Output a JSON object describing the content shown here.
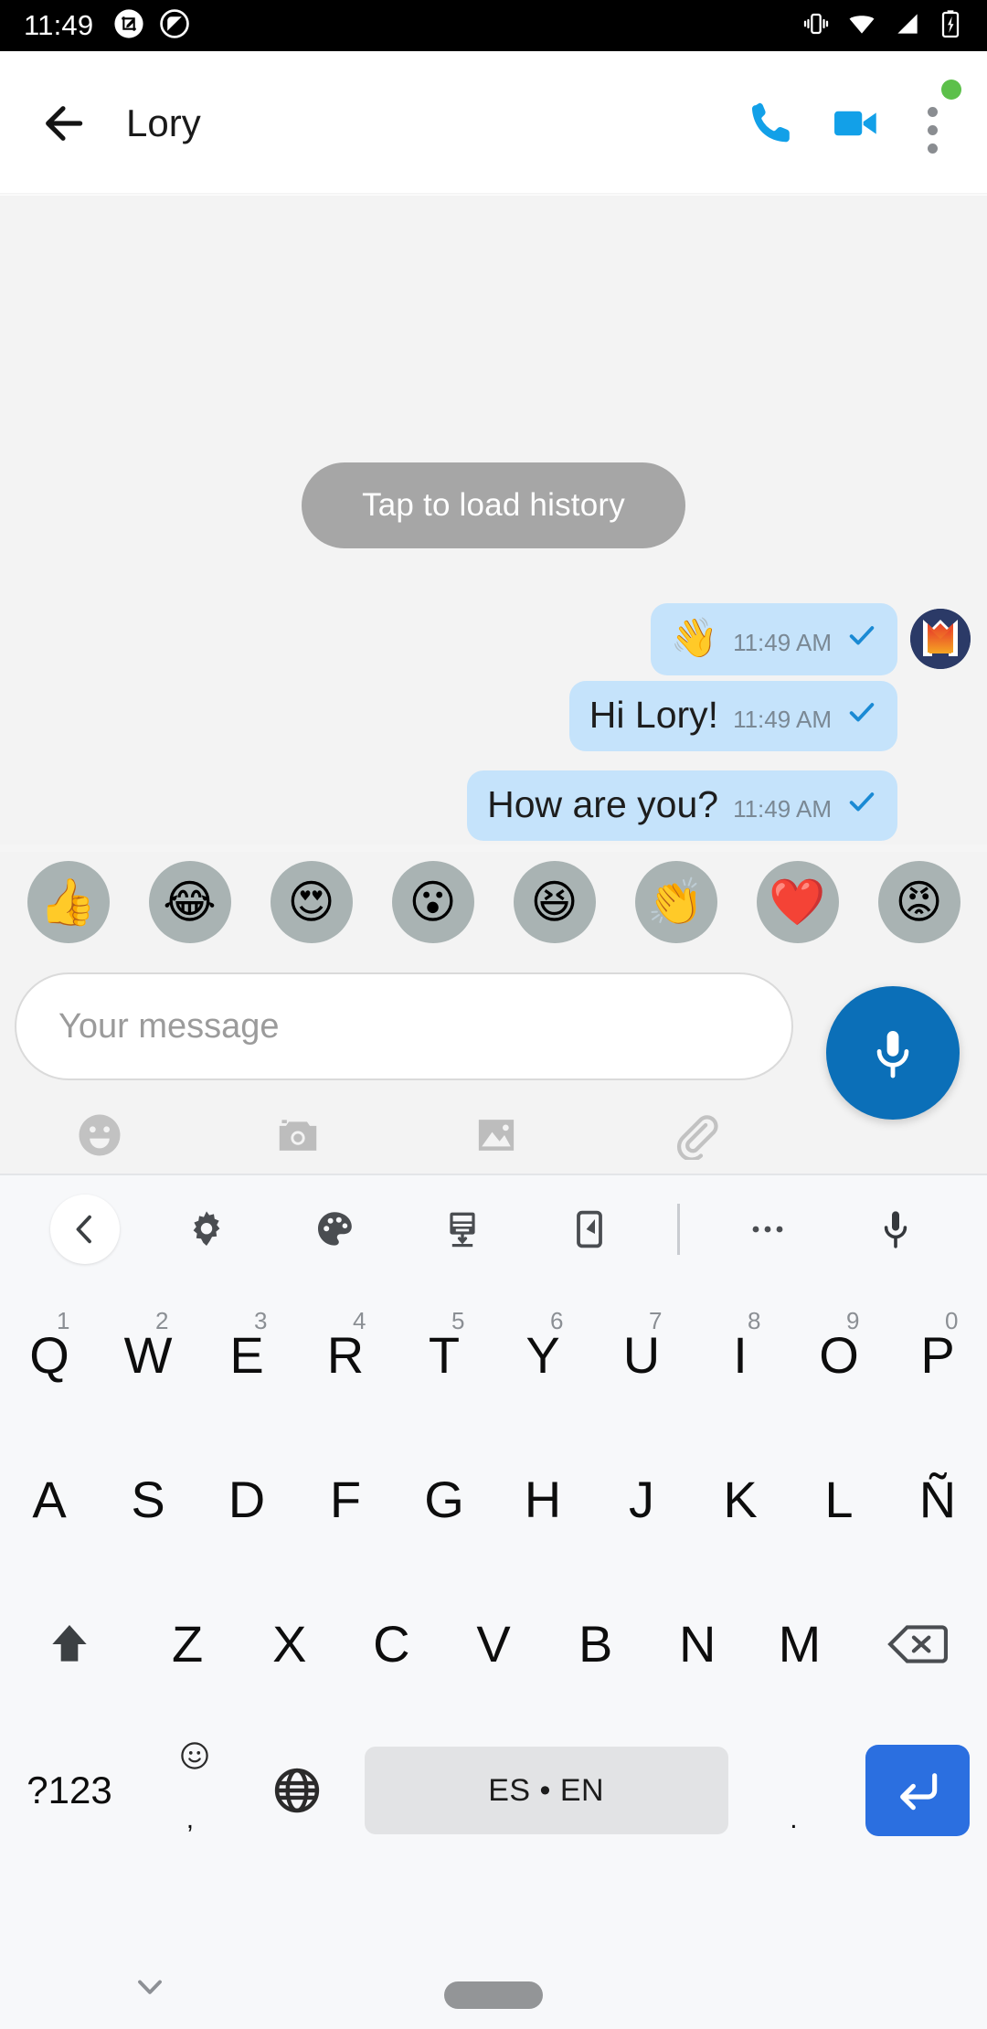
{
  "status_bar": {
    "time": "11:49",
    "left_icons": [
      "screenshot-crop-icon",
      "do-not-disturb-icon"
    ],
    "right_icons": [
      "vibrate-icon",
      "wifi-icon",
      "cellular-signal-icon",
      "battery-charging-icon"
    ]
  },
  "app_bar": {
    "back_icon": "back-arrow-icon",
    "contact_name": "Lory",
    "call_icon": "phone-call-icon",
    "video_icon": "video-camera-icon",
    "overflow_icon": "more-vertical-icon",
    "status_dot_color": "#5cc04a",
    "accent_color": "#12a0e8"
  },
  "conversation": {
    "load_history_label": "Tap to load history",
    "messages": [
      {
        "text": "👋",
        "emoji_only": true,
        "time": "11:49 AM",
        "status_icon": "check-sent-icon",
        "has_avatar": true
      },
      {
        "text": "Hi Lory!",
        "emoji_only": false,
        "time": "11:49 AM",
        "status_icon": "check-sent-icon",
        "has_avatar": false
      },
      {
        "text": "How are you?",
        "emoji_only": false,
        "time": "11:49 AM",
        "status_icon": "check-sent-icon",
        "has_avatar": false
      }
    ],
    "bubble_color": "#c5e3fb",
    "check_color": "#1a8ad4"
  },
  "reactions": [
    {
      "emoji": "👍",
      "name": "thumbs-up"
    },
    {
      "emoji": "😂",
      "name": "tears-of-joy"
    },
    {
      "emoji": "😍",
      "name": "heart-eyes"
    },
    {
      "emoji": "😮",
      "name": "open-mouth"
    },
    {
      "emoji": "😆",
      "name": "squinting-laugh"
    },
    {
      "emoji": "👏",
      "name": "clapping-hands"
    },
    {
      "emoji": "❤️",
      "name": "red-heart"
    },
    {
      "emoji": "😡",
      "name": "angry-face"
    }
  ],
  "composer": {
    "placeholder": "Your message",
    "value": "",
    "mic_icon": "microphone-icon",
    "mic_color": "#0b6fb8",
    "attachments": [
      {
        "name": "emoji-icon"
      },
      {
        "name": "camera-icon"
      },
      {
        "name": "gallery-image-icon"
      },
      {
        "name": "paperclip-attach-icon"
      }
    ]
  },
  "keyboard": {
    "toolbar": [
      {
        "name": "back-chevron-icon",
        "highlighted": true
      },
      {
        "name": "gear-settings-icon",
        "highlighted": false
      },
      {
        "name": "palette-theme-icon",
        "highlighted": false
      },
      {
        "name": "keyboard-resize-icon",
        "highlighted": false
      },
      {
        "name": "one-handed-mode-icon",
        "highlighted": false
      },
      {
        "name": "divider",
        "highlighted": false
      },
      {
        "name": "more-horizontal-icon",
        "highlighted": false
      },
      {
        "name": "voice-input-microphone-icon",
        "highlighted": false
      }
    ],
    "row1": [
      {
        "char": "Q",
        "hint": "1"
      },
      {
        "char": "W",
        "hint": "2"
      },
      {
        "char": "E",
        "hint": "3"
      },
      {
        "char": "R",
        "hint": "4"
      },
      {
        "char": "T",
        "hint": "5"
      },
      {
        "char": "Y",
        "hint": "6"
      },
      {
        "char": "U",
        "hint": "7"
      },
      {
        "char": "I",
        "hint": "8"
      },
      {
        "char": "O",
        "hint": "9"
      },
      {
        "char": "P",
        "hint": "0"
      }
    ],
    "row2": [
      {
        "char": "A"
      },
      {
        "char": "S"
      },
      {
        "char": "D"
      },
      {
        "char": "F"
      },
      {
        "char": "G"
      },
      {
        "char": "H"
      },
      {
        "char": "J"
      },
      {
        "char": "K"
      },
      {
        "char": "L"
      },
      {
        "char": "Ñ"
      }
    ],
    "row3": [
      {
        "char": "Z"
      },
      {
        "char": "X"
      },
      {
        "char": "C"
      },
      {
        "char": "V"
      },
      {
        "char": "B"
      },
      {
        "char": "N"
      },
      {
        "char": "M"
      }
    ],
    "shift_icon": "shift-arrow-icon",
    "backspace_icon": "backspace-delete-icon",
    "symbols_label": "?123",
    "comma_label": ",",
    "comma_sup_icon": "emoji-smiley-icon",
    "globe_icon": "language-globe-icon",
    "space_label": "ES • EN",
    "period_label": ".",
    "enter_icon": "enter-return-icon",
    "enter_color": "#2b6fe0",
    "space_key_color": "#e2e3e5"
  },
  "nav_bar": {
    "dismiss_keyboard_icon": "chevron-down-icon",
    "gesture_pill": "home-gesture-pill"
  }
}
